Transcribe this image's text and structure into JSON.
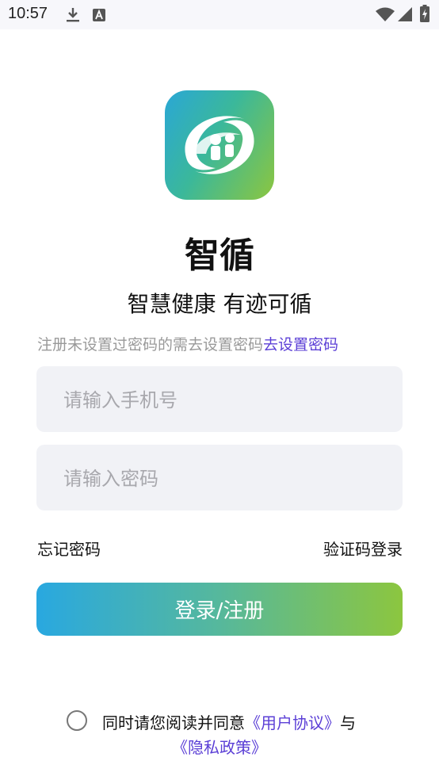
{
  "status_bar": {
    "time": "10:57",
    "icons": [
      "download-icon",
      "a-badge-icon",
      "wifi-icon",
      "signal-icon",
      "battery-icon"
    ]
  },
  "app": {
    "name": "智循",
    "slogan": "智慧健康 有迹可循",
    "logo_colors": [
      "#2aa7d6",
      "#8cc63f"
    ]
  },
  "hint": {
    "text": "注册未设置过密码的需去设置密码",
    "link": "去设置密码"
  },
  "form": {
    "phone_placeholder": "请输入手机号",
    "password_placeholder": "请输入密码",
    "forgot_password": "忘记密码",
    "sms_login": "验证码登录",
    "submit_label": "登录/注册"
  },
  "agreement": {
    "prefix": "同时请您阅读并同意",
    "user_agreement": "《用户协议》",
    "conjunction": "与",
    "privacy_policy": "《隐私政策》",
    "checked": false
  },
  "colors": {
    "link": "#5b3fd6",
    "button_gradient": [
      "#29a8e0",
      "#8cc63f"
    ],
    "input_bg": "#f1f2f6"
  }
}
